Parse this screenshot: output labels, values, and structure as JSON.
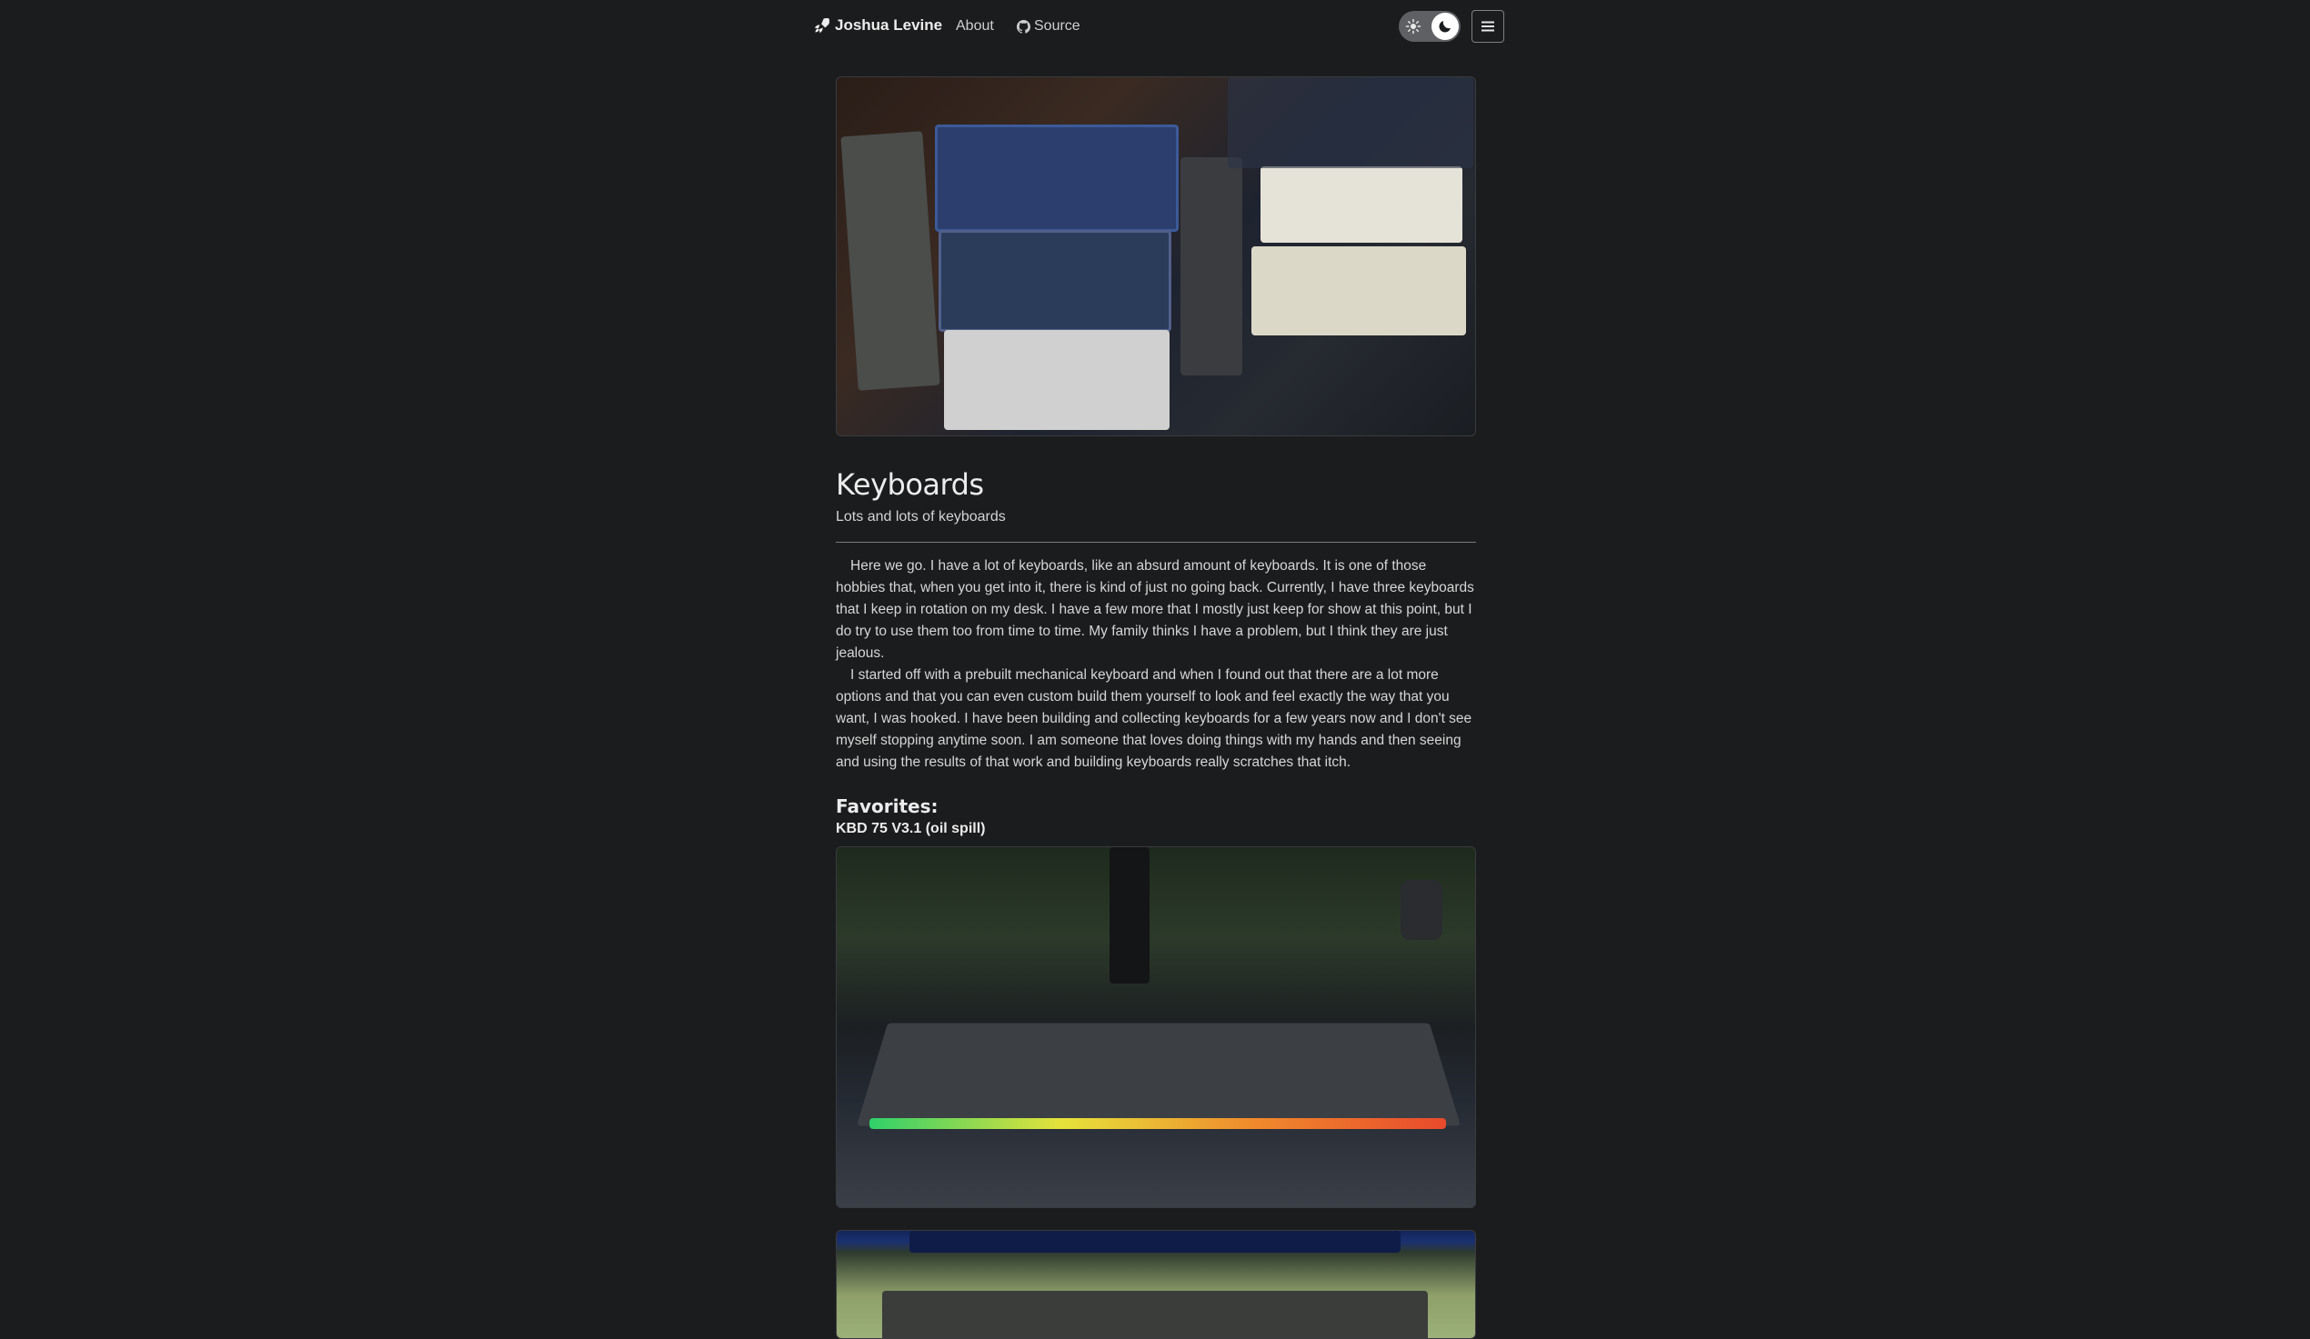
{
  "nav": {
    "brand": "Joshua Levine",
    "about": "About",
    "source": "Source"
  },
  "icons": {
    "brand": "rocket-icon",
    "source": "github-icon",
    "theme_light": "sun-icon",
    "theme_dark": "moon-icon",
    "menu": "hamburger-menu-icon"
  },
  "page": {
    "title": "Keyboards",
    "subtitle": "Lots and lots of keyboards",
    "paragraphs": [
      "Here we go. I have a lot of keyboards, like an absurd amount of keyboards. It is one of those hobbies that, when you get into it, there is kind of just no going back. Currently, I have three keyboards that I keep in rotation on my desk. I have a few more that I mostly just keep for show at this point, but I do try to use them too from time to time. My family thinks I have a problem, but I think they are just jealous.",
      "I started off with a prebuilt mechanical keyboard and when I found out that there are a lot more options and that you can even custom build them yourself to look and feel exactly the way that you want, I was hooked. I have been building and collecting keyboards for a few years now and I don't see myself stopping anytime soon. I am someone that loves doing things with my hands and then seeing and using the results of that work and building keyboards really scratches that itch."
    ],
    "favorites_heading": "Favorites:",
    "favorite_1": "KBD 75 V3.1 (oil spill)"
  },
  "colors": {
    "background": "#1b1c1e",
    "text": "#d4d4d4",
    "heading": "#ececec",
    "toggle_track": "#5f6064"
  }
}
